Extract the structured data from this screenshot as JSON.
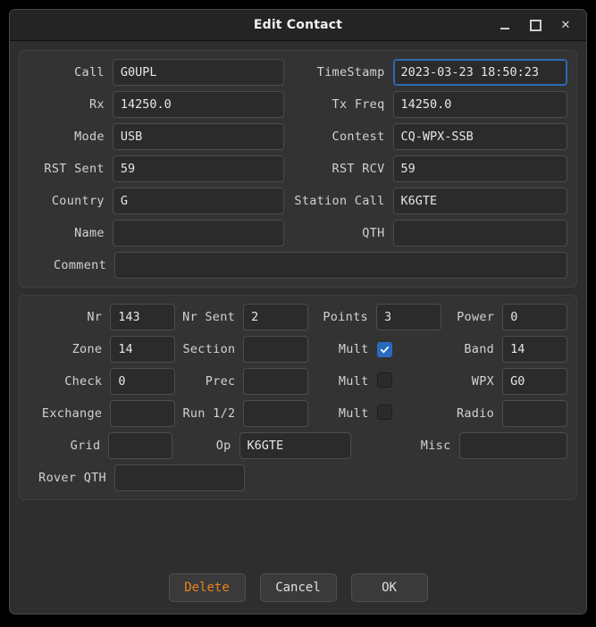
{
  "window": {
    "title": "Edit Contact",
    "controls": [
      {
        "name": "minimize-button",
        "glyph": "minimize-icon",
        "label": "–"
      },
      {
        "name": "maximize-button",
        "glyph": "maximize-icon",
        "label": "□"
      },
      {
        "name": "close-button",
        "glyph": "close-icon",
        "label": "✕"
      }
    ]
  },
  "colors": {
    "accent_focus": "#2d6ab4",
    "checkbox_on": "#2a6bbf",
    "delete_text": "#e8821e",
    "window_bg": "#2e2e2e",
    "group_bg": "#333333",
    "field_bg": "#2b2b2b"
  },
  "top_panel": {
    "rows": [
      {
        "left": {
          "label": "Call",
          "value": "G0UPL",
          "focused": false
        },
        "right": {
          "label": "TimeStamp",
          "value": "2023-03-23 18:50:23",
          "focused": true
        }
      },
      {
        "left": {
          "label": "Rx",
          "value": "14250.0",
          "focused": false
        },
        "right": {
          "label": "Tx Freq",
          "value": "14250.0",
          "focused": false
        }
      },
      {
        "left": {
          "label": "Mode",
          "value": "USB",
          "focused": false
        },
        "right": {
          "label": "Contest",
          "value": "CQ-WPX-SSB",
          "focused": false
        }
      },
      {
        "left": {
          "label": "RST Sent",
          "value": "59",
          "focused": false
        },
        "right": {
          "label": "RST RCV",
          "value": "59",
          "focused": false
        }
      },
      {
        "left": {
          "label": "Country",
          "value": "G",
          "focused": false
        },
        "right": {
          "label": "Station Call",
          "value": "K6GTE",
          "focused": false
        }
      },
      {
        "left": {
          "label": "Name",
          "value": "",
          "focused": false
        },
        "right": {
          "label": "QTH",
          "value": "",
          "focused": false
        }
      }
    ],
    "comment": {
      "label": "Comment",
      "value": ""
    }
  },
  "bottom_panel": {
    "row1": {
      "nr": {
        "label": "Nr",
        "value": "143"
      },
      "nr_sent": {
        "label": "Nr Sent",
        "value": "2"
      },
      "points": {
        "label": "Points",
        "value": "3"
      },
      "power": {
        "label": "Power",
        "value": "0"
      }
    },
    "row2": {
      "zone": {
        "label": "Zone",
        "value": "14"
      },
      "section": {
        "label": "Section",
        "value": ""
      },
      "mult": {
        "label": "Mult",
        "checked": true
      },
      "band": {
        "label": "Band",
        "value": "14"
      }
    },
    "row3": {
      "check": {
        "label": "Check",
        "value": "0"
      },
      "prec": {
        "label": "Prec",
        "value": ""
      },
      "mult": {
        "label": "Mult",
        "checked": false
      },
      "wpx": {
        "label": "WPX",
        "value": "G0"
      }
    },
    "row4": {
      "exchange": {
        "label": "Exchange",
        "value": ""
      },
      "run": {
        "label": "Run 1/2",
        "value": ""
      },
      "mult": {
        "label": "Mult",
        "checked": false
      },
      "radio": {
        "label": "Radio",
        "value": ""
      }
    },
    "row5": {
      "grid": {
        "label": "Grid",
        "value": ""
      },
      "op": {
        "label": "Op",
        "value": "K6GTE"
      },
      "misc": {
        "label": "Misc",
        "value": ""
      }
    },
    "row6": {
      "rover_qth": {
        "label": "Rover QTH",
        "value": ""
      }
    }
  },
  "buttons": {
    "delete": "Delete",
    "cancel": "Cancel",
    "ok": "OK"
  }
}
